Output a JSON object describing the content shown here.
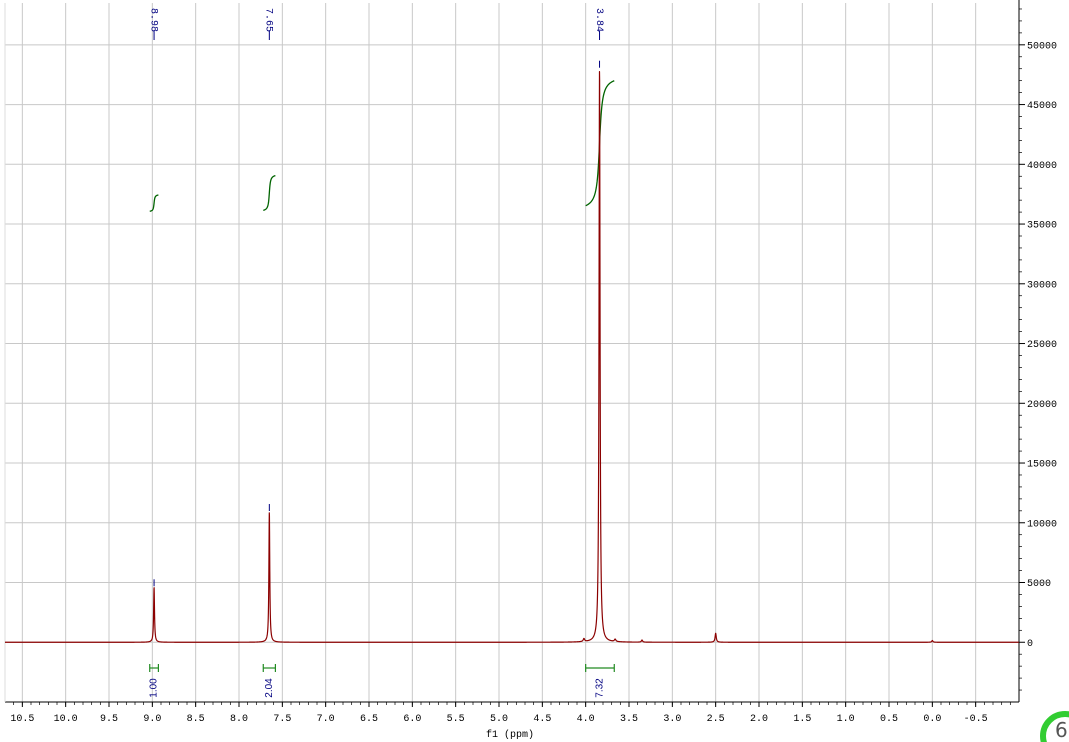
{
  "chart_data": {
    "type": "line",
    "xlabel": "f1 (ppm)",
    "ylabel": "",
    "xlim": [
      10.7,
      -1.0
    ],
    "ylim": [
      -5000,
      53500
    ],
    "x_ticks": [
      10.5,
      10.0,
      9.5,
      9.0,
      8.5,
      8.0,
      7.5,
      7.0,
      6.5,
      6.0,
      5.5,
      5.0,
      4.5,
      4.0,
      3.5,
      3.0,
      2.5,
      2.0,
      1.5,
      1.0,
      0.5,
      0.0,
      -0.5
    ],
    "x_tick_labels": [
      "10.5",
      "10.0",
      "9.5",
      "9.0",
      "8.5",
      "8.0",
      "7.5",
      "7.0",
      "6.5",
      "6.0",
      "5.5",
      "5.0",
      "4.5",
      "4.0",
      "3.5",
      "3.0",
      "2.5",
      "2.0",
      "1.5",
      "1.0",
      "0.5",
      "0.0",
      "-0.5"
    ],
    "y_ticks": [
      0,
      5000,
      10000,
      15000,
      20000,
      25000,
      30000,
      35000,
      40000,
      45000,
      50000
    ],
    "y_tick_labels": [
      "0",
      "5000",
      "10000",
      "15000",
      "20000",
      "25000",
      "30000",
      "35000",
      "40000",
      "45000",
      "50000"
    ],
    "grid": true,
    "series": [
      {
        "color": "#8b0000",
        "peaks": [
          {
            "x": 8.98,
            "height": 4600,
            "width": 0.006
          },
          {
            "x": 7.65,
            "height": 10900,
            "width": 0.006
          },
          {
            "x": 3.84,
            "height": 48000,
            "width": 0.007
          },
          {
            "x": 2.5,
            "height": 750,
            "width": 0.008
          },
          {
            "x": 4.02,
            "height": 250,
            "width": 0.01
          },
          {
            "x": 3.66,
            "height": 200,
            "width": 0.01
          },
          {
            "x": 3.35,
            "height": 180,
            "width": 0.008
          },
          {
            "x": 0.0,
            "height": 150,
            "width": 0.008
          }
        ]
      }
    ],
    "peak_labels": [
      {
        "x": 8.98,
        "text": "8.98"
      },
      {
        "x": 7.65,
        "text": "7.65"
      },
      {
        "x": 3.84,
        "text": "3.84"
      }
    ],
    "integrals": [
      {
        "from": 9.03,
        "to": 8.93,
        "value": "1.00"
      },
      {
        "from": 7.72,
        "to": 7.58,
        "value": "2.04"
      },
      {
        "from": 4.0,
        "to": 3.67,
        "value": "7.32"
      }
    ],
    "colors": {
      "spectrum": "#8b0000",
      "integral_curve": "#006400",
      "integral_bar": "#228b22",
      "labels": "#000080",
      "grid": "#c8c8c8"
    }
  },
  "badge": {
    "text": "6",
    "color": "#32cd32"
  }
}
